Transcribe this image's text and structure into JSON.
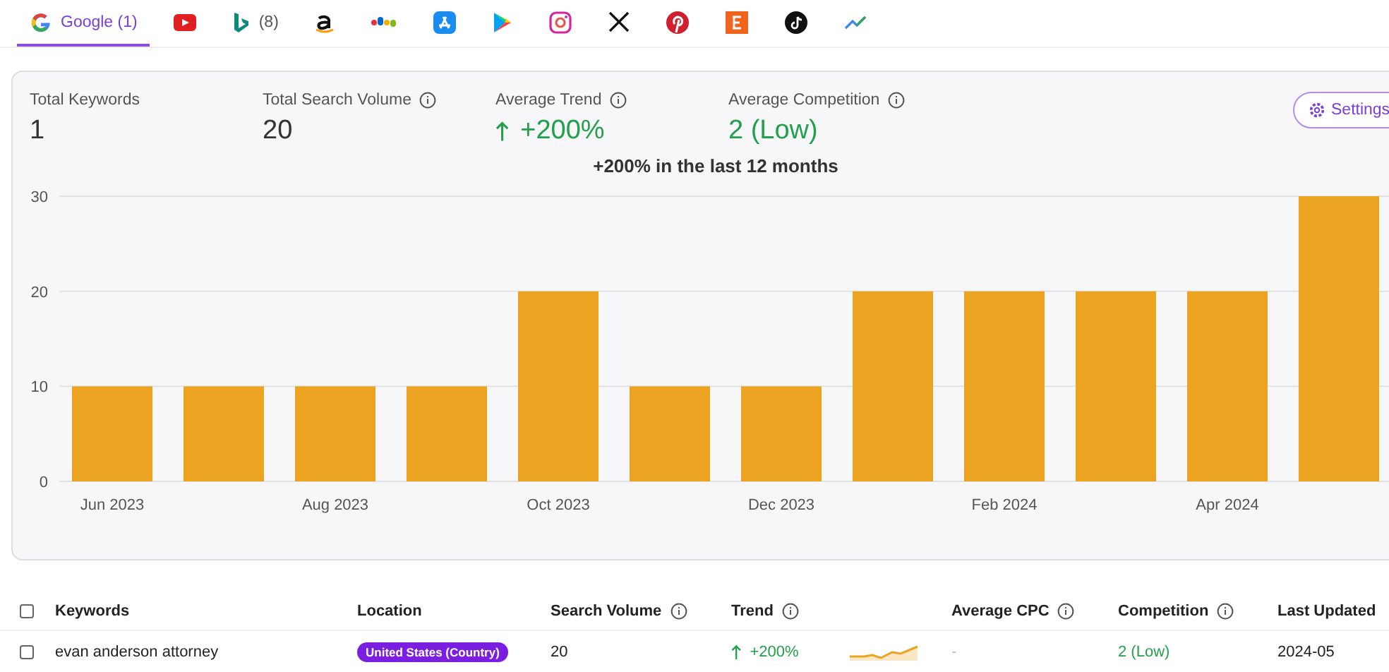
{
  "tabs": [
    {
      "kind": "google",
      "label": "Google (1)",
      "selected": true
    },
    {
      "kind": "youtube",
      "selected": false
    },
    {
      "kind": "bing",
      "label": "(8)",
      "selected": false
    },
    {
      "kind": "amazon",
      "selected": false
    },
    {
      "kind": "ebay",
      "selected": false
    },
    {
      "kind": "appstore",
      "selected": false
    },
    {
      "kind": "play",
      "selected": false
    },
    {
      "kind": "instagram",
      "selected": false
    },
    {
      "kind": "x",
      "selected": false
    },
    {
      "kind": "pinterest",
      "selected": false
    },
    {
      "kind": "etsy",
      "selected": false
    },
    {
      "kind": "tiktok",
      "selected": false
    },
    {
      "kind": "trends",
      "selected": false
    }
  ],
  "stats": [
    {
      "label": "Total Keywords",
      "value": "1",
      "info": false,
      "kind": "plain"
    },
    {
      "label": "Total Search Volume",
      "value": "20",
      "info": true,
      "kind": "plain"
    },
    {
      "label": "Average Trend",
      "value": "+200%",
      "info": true,
      "kind": "up"
    },
    {
      "label": "Average Competition",
      "value": "2 (Low)",
      "info": true,
      "kind": "good"
    }
  ],
  "settings_button": "Settings",
  "chart_data": {
    "type": "bar",
    "title": "+200% in the last 12 months",
    "categories": [
      "Jun 2023",
      null,
      "Aug 2023",
      null,
      "Oct 2023",
      null,
      "Dec 2023",
      null,
      "Feb 2024",
      null,
      "Apr 2024",
      null
    ],
    "series": [
      {
        "color": "#eca321",
        "values": [
          10,
          10,
          10,
          10,
          20,
          10,
          10,
          20,
          20,
          20,
          20,
          30
        ]
      }
    ],
    "ylim": [
      0,
      30
    ],
    "yticks": [
      0,
      10,
      20,
      30
    ]
  },
  "table": {
    "select_all_checked": false,
    "columns": [
      {
        "label": "Keywords",
        "info": false
      },
      {
        "label": "Location",
        "info": false
      },
      {
        "label": "Search Volume",
        "info": true
      },
      {
        "label": "Trend",
        "info": true
      },
      {
        "label": "Average CPC",
        "info": true
      },
      {
        "label": "Competition",
        "info": true
      },
      {
        "label": "Last Updated",
        "info": false
      }
    ],
    "rows": [
      {
        "checked": false,
        "keyword": "evan anderson attorney",
        "location": "United States (Country)",
        "search_volume": "20",
        "trend": "+200%",
        "average_cpc": "-",
        "competition": "2 (Low)",
        "last_updated": "2024-05"
      }
    ]
  }
}
